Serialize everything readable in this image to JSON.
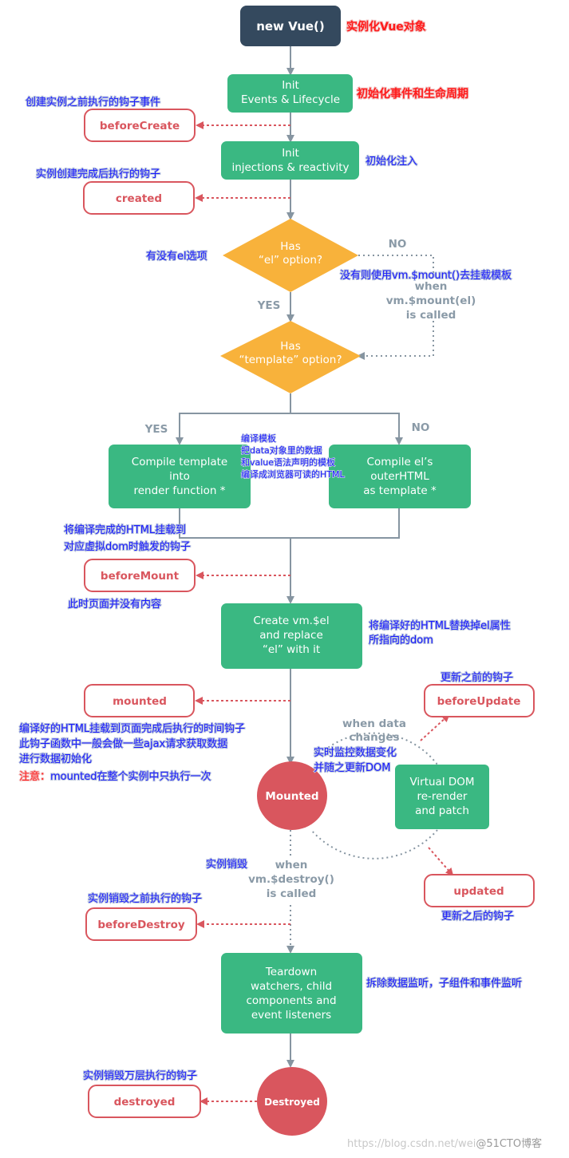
{
  "colors": {
    "dark": "#34495e",
    "green": "#3ab882",
    "amber": "#f8b23b",
    "red": "#d9565e",
    "gray": "#8695a1",
    "annotation_blue": "#1a1aff",
    "annotation_red": "#ff1a1a"
  },
  "nodes": {
    "new_vue": "new Vue()",
    "init_events": [
      "Init",
      "Events & Lifecycle"
    ],
    "init_injections": [
      "Init",
      "injections & reactivity"
    ],
    "has_el": [
      "Has",
      "“el” option?"
    ],
    "has_template": [
      "Has",
      "“template” option?"
    ],
    "compile_template": [
      "Compile template",
      "into",
      "render function *"
    ],
    "compile_el": [
      "Compile el’s",
      "outerHTML",
      "as template *"
    ],
    "create_el": [
      "Create vm.$el",
      "and replace",
      "“el” with it"
    ],
    "mounted": "Mounted",
    "virtual_dom": [
      "Virtual DOM",
      "re-render",
      "and patch"
    ],
    "teardown": [
      "Teardown",
      "watchers, child",
      "components and",
      "event listeners"
    ],
    "destroyed": "Destroyed"
  },
  "hooks": {
    "before_create": "beforeCreate",
    "created": "created",
    "before_mount": "beforeMount",
    "mounted": "mounted",
    "before_update": "beforeUpdate",
    "updated": "updated",
    "before_destroy": "beforeDestroy",
    "destroyed": "destroyed"
  },
  "labels": {
    "no_1": "NO",
    "yes_1": "YES",
    "when_mount": [
      "when",
      "vm.$mount(el)",
      "is called"
    ],
    "yes_2": "YES",
    "no_2": "NO",
    "when_data": [
      "when data",
      "changes"
    ],
    "when_destroy": [
      "when",
      "vm.$destroy()",
      "is called"
    ]
  },
  "annotations": {
    "new_vue": "实例化Vue对象",
    "init_events": "初始化事件和生命周期",
    "before_create": "创建实例之前执行的钩子事件",
    "init_injections": "初始化注入",
    "created": "实例创建完成后执行的钩子",
    "has_el": "有没有el选项",
    "mount_hint": "没有则使用vm.$mount()去挂载模板",
    "compile": [
      "编译模板",
      "把data对象里的数据",
      "和value语法声明的模板",
      "编译成浏览器可读的HTML"
    ],
    "before_mount_top": [
      "将编译完成的HTML挂载到",
      "对应虚拟dom时触发的钩子"
    ],
    "before_mount_bottom": "此时页面并没有内容",
    "create_el": [
      "将编译好的HTML替换掉el属性",
      "所指向的dom"
    ],
    "before_update": "更新之前的钩子",
    "mounted": [
      "编译好的HTML挂载到页面完成后执行的时间钩子",
      "此钩子函数中一般会做一些ajax请求获取数据",
      "进行数据初始化"
    ],
    "mounted_note_prefix": "注意：",
    "mounted_note": "mounted在整个实例中只执行一次",
    "data_watch": [
      "实时监控数据变化",
      "并随之更新DOM"
    ],
    "destroy": "实例销毁",
    "updated": "更新之后的钩子",
    "before_destroy": "实例销毁之前执行的钩子",
    "teardown": "拆除数据监听，子组件和事件监听",
    "destroyed": "实例销毁万层执行的钩子"
  },
  "watermark": {
    "url": "https://blog.csdn.net/wei",
    "site": "@51CTO博客"
  }
}
